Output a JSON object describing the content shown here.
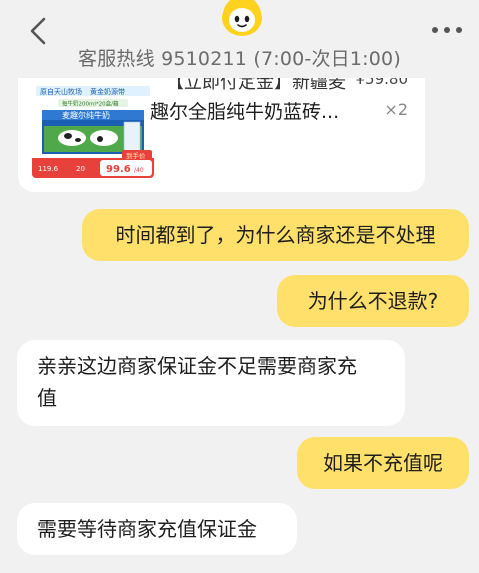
{
  "header": {
    "hotline": "客服热线 9510211 (7:00-次日1:00)"
  },
  "product": {
    "title_line1": "【立即付定金】新疆麦",
    "title_line2": "趣尔全脂纯牛奶蓝砖...",
    "price": "¥59.80",
    "quantity": "×2",
    "image": {
      "banner_left": "原自天山牧场",
      "banner_right": "黄金奶源带",
      "sub_banner": "每牛奶200ml*20盒/箱",
      "box_text": "麦趣尔纯牛奶",
      "tag": "到手价",
      "price_old": "119.6",
      "coupon": "20",
      "price_new": "99.6",
      "price_unit": "/40"
    }
  },
  "messages": [
    {
      "from": "user",
      "text": "时间都到了，为什么商家还是不处理"
    },
    {
      "from": "user",
      "text": "为什么不退款?"
    },
    {
      "from": "agent",
      "line1": "亲亲这边商家保证金不足需要商家充",
      "line2": "值"
    },
    {
      "from": "user",
      "text": "如果不充值呢"
    },
    {
      "from": "agent",
      "text": "需要等待商家充值保证金"
    }
  ],
  "colors": {
    "user_bubble": "#ffe06b",
    "agent_bubble": "#ffffff",
    "background": "#f1f1f1"
  }
}
